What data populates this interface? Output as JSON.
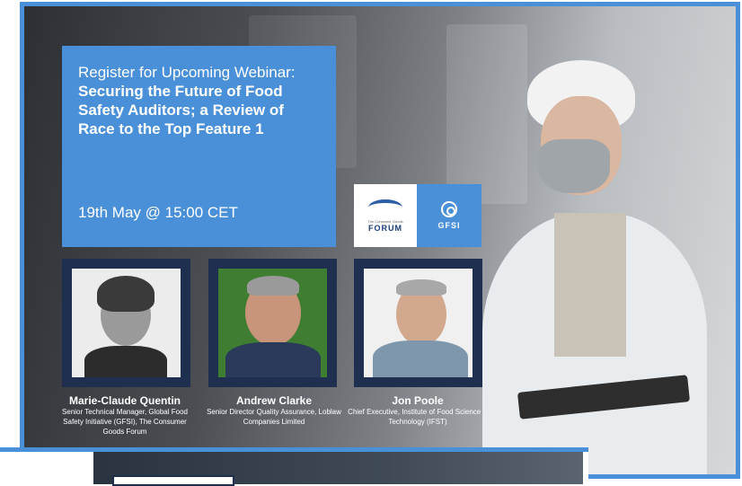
{
  "banner": {
    "intro": "Register for Upcoming Webinar:",
    "title": "Securing the Future of Food Safety Auditors; a Review of Race to the Top Feature 1",
    "date": "19th May @ 15:00 CET"
  },
  "logos": {
    "cgf_tag": "The Consumer Goods",
    "cgf_word": "FORUM",
    "gfsi_word": "GFSI"
  },
  "speakers": [
    {
      "name": "Marie-Claude Quentin",
      "role": "Senior Technical Manager, Global Food Safety Initiative (GFSI), The Consumer Goods Forum"
    },
    {
      "name": "Andrew Clarke",
      "role": "Senior Director Quality Assurance, Loblaw Companies Limited"
    },
    {
      "name": "Jon Poole",
      "role": "Chief Executive, Institute of Food Science & Technology (IFST)"
    }
  ],
  "colors": {
    "accent": "#4a90d9",
    "card": "#1f2f4f"
  }
}
